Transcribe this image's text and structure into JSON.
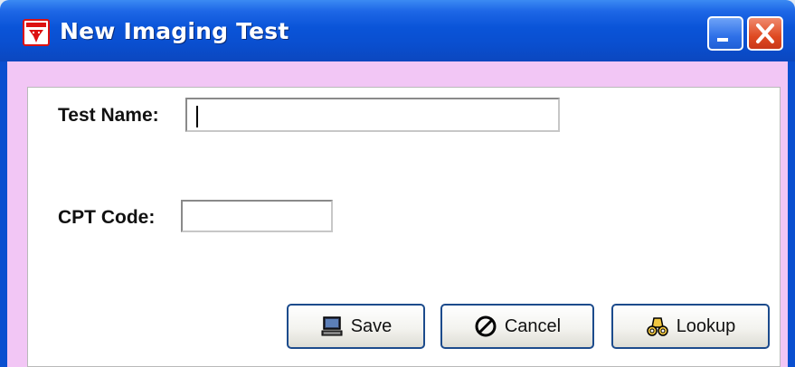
{
  "window": {
    "title": "New Imaging Test",
    "icons": {
      "app": "app-icon",
      "minimize": "minimize-icon",
      "close": "close-icon"
    }
  },
  "form": {
    "test_name": {
      "label": "Test Name:",
      "value": ""
    },
    "cpt_code": {
      "label": "CPT Code:",
      "value": ""
    }
  },
  "buttons": {
    "save": {
      "label": "Save",
      "icon": "computer-icon"
    },
    "cancel": {
      "label": "Cancel",
      "icon": "no-entry-icon"
    },
    "lookup": {
      "label": "Lookup",
      "icon": "binoculars-icon"
    }
  },
  "colors": {
    "titlebar": "#0a4fd0",
    "accent_band": "#f2c6f5",
    "close_button": "#df4a22"
  }
}
